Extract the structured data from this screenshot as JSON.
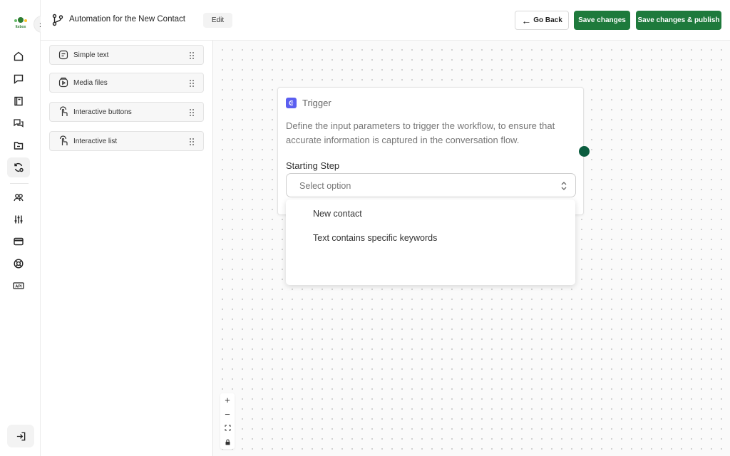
{
  "brand": {
    "logo_text": "Itsbox"
  },
  "header": {
    "title": "Automation for the New Contact",
    "edit_label": "Edit",
    "go_back_label": "Go Back",
    "save_label": "Save changes",
    "publish_label": "Save changes & publish"
  },
  "sidebar": {
    "items": [
      {
        "icon": "home-icon"
      },
      {
        "icon": "chat-icon"
      },
      {
        "icon": "book-icon"
      },
      {
        "icon": "conversations-icon"
      },
      {
        "icon": "folder-icon"
      },
      {
        "icon": "automation-icon",
        "active": true
      },
      {
        "icon": "contacts-icon"
      },
      {
        "icon": "settings-sliders-icon"
      },
      {
        "icon": "billing-card-icon"
      },
      {
        "icon": "support-icon"
      },
      {
        "icon": "api-icon"
      }
    ],
    "logout_icon": "logout-icon"
  },
  "components": [
    {
      "label": "Simple text",
      "icon": "text-message-icon"
    },
    {
      "label": "Media files",
      "icon": "media-play-icon"
    },
    {
      "label": "Interactive buttons",
      "icon": "pointer-icon"
    },
    {
      "label": "Interactive list",
      "icon": "pointer-icon"
    }
  ],
  "trigger_card": {
    "title": "Trigger",
    "description": "Define the input parameters to trigger the workflow, to ensure that accurate information is captured in the conversation flow.",
    "field_label": "Starting Step",
    "select_placeholder": "Select option",
    "options": [
      "New contact",
      "Text contains specific keywords"
    ]
  },
  "zoom_controls": [
    "+",
    "−"
  ],
  "colors": {
    "primary_green": "#1e7a3c",
    "connector": "#0b5d3f",
    "trigger_accent": "#5b5ff0"
  }
}
